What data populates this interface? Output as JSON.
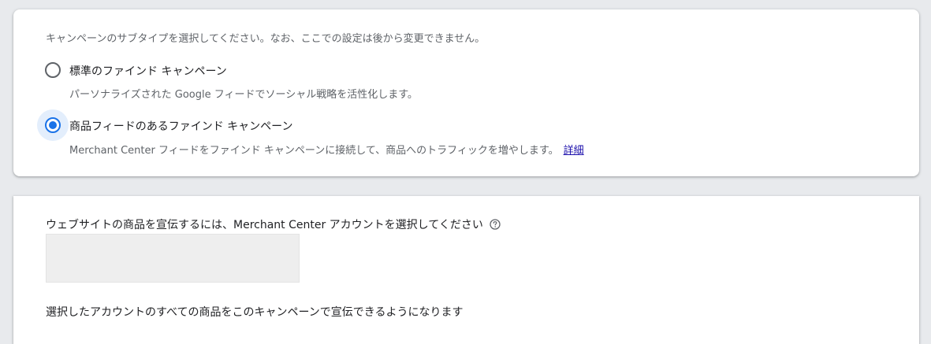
{
  "subtype_card": {
    "instruction": "キャンペーンのサブタイプを選択してください。なお、ここでの設定は後から変更できません。",
    "options": [
      {
        "label": "標準のファインド キャンペーン",
        "description": "パーソナライズされた Google フィードでソーシャル戦略を活性化します。",
        "selected": false
      },
      {
        "label": "商品フィードのあるファインド キャンペーン",
        "description": "Merchant Center フィードをファインド キャンペーンに接続して、商品へのトラフィックを増やします。",
        "link_text": "詳細",
        "selected": true
      }
    ]
  },
  "merchant_card": {
    "label": "ウェブサイトの商品を宣伝するには、Merchant Center アカウントを選択してください",
    "help_icon": "help-circle-icon",
    "note": "選択したアカウントのすべての商品をこのキャンペーンで宣伝できるようになります"
  },
  "colors": {
    "accent": "#1a73e8",
    "link": "#1a0dab",
    "background": "#e8eaed"
  }
}
